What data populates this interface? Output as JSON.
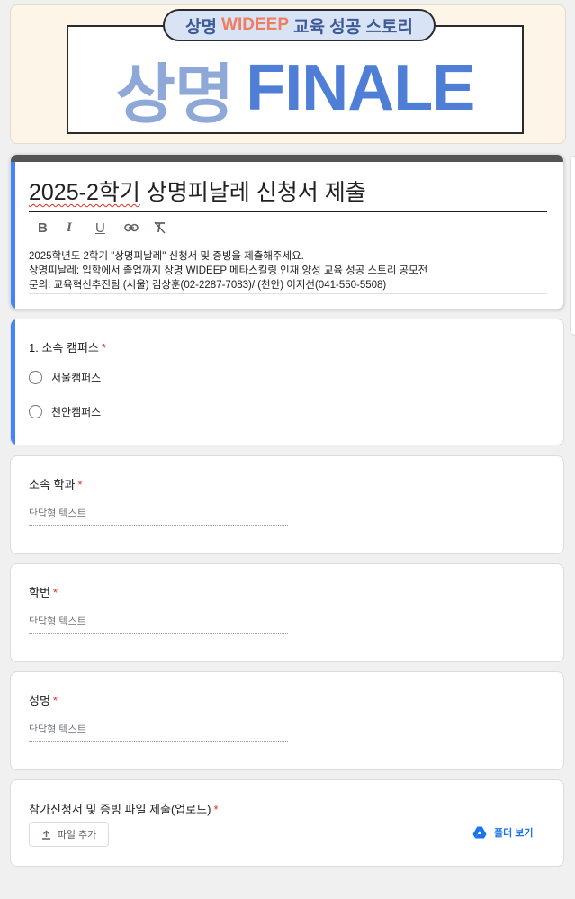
{
  "banner": {
    "subtitle_pre": "상명",
    "subtitle_accent": "WIDEEP",
    "subtitle_post": "교육 성공 스토리",
    "title_ko": "상명",
    "title_en": "FINALE"
  },
  "form": {
    "title_main": "2025-2학기",
    "title_rest": " 상명피날레 신청서 제출",
    "toolbar": {
      "bold": "B",
      "italic": "I",
      "underline": "U"
    },
    "description": [
      "2025학년도 2학기 \"상명피날레\" 신청서 및 증빙을 제출해주세요.",
      "상명피날레: 입학에서 졸업까지 상명 WIDEEP 메타스킬링 인재 양성 교육 성공 스토리 공모전",
      "문의: 교육혁신추진팀 (서울) 김상훈(02-2287-7083)/ (천안) 이지선(041-550-5508)"
    ]
  },
  "questions": {
    "campus": {
      "label": "1. 소속 캠퍼스",
      "required_mark": "*",
      "options": [
        "서울캠퍼스",
        "천안캠퍼스"
      ]
    },
    "department": {
      "label": "소속 학과",
      "required_mark": "*",
      "placeholder": "단답형 텍스트"
    },
    "student_id": {
      "label": "학번",
      "required_mark": "*",
      "placeholder": "단답형 텍스트"
    },
    "name": {
      "label": "성명",
      "required_mark": "*",
      "placeholder": "단답형 텍스트"
    },
    "upload": {
      "label": "참가신청서 및 증빙 파일 제출(업로드)",
      "required_mark": "*",
      "add_file_label": "파일 추가",
      "folder_label": "폴더 보기"
    }
  },
  "colors": {
    "accent": "#4285f4",
    "required": "#d93025",
    "link": "#1a73e8",
    "banner_title_en": "#4f7ed6",
    "banner_title_ko": "#8ea9d8",
    "banner_accent": "#ef7e61"
  },
  "icons": {
    "toolbar": [
      "bold-icon",
      "italic-icon",
      "underline-icon",
      "link-icon",
      "clear-format-icon"
    ],
    "upload": "upload-icon",
    "folder": "google-drive-icon"
  }
}
